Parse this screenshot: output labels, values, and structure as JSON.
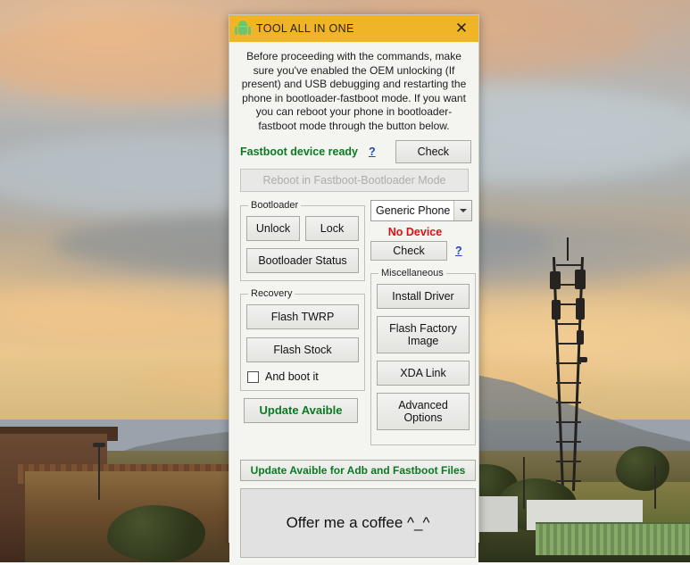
{
  "window": {
    "title": "TOOL ALL IN ONE",
    "icon": "android-robot-icon",
    "close_label": "✕",
    "titlebar_color": "#f0b429"
  },
  "intro_text": "Before proceeding with the commands, make sure you've enabled the OEM unlocking (If present) and USB debugging and restarting the phone in bootloader-fastboot mode. If you want you can reboot your phone in bootloader-fastboot mode through the button below.",
  "fastboot": {
    "status_text": "Fastboot device ready",
    "status_color": "#0a7a22",
    "help_label": "?",
    "check_label": "Check",
    "reboot_label": "Reboot in Fastboot-Bootloader Mode",
    "reboot_enabled": false
  },
  "bootloader": {
    "legend": "Bootloader",
    "unlock_label": "Unlock",
    "lock_label": "Lock",
    "status_label": "Bootloader Status"
  },
  "recovery": {
    "legend": "Recovery",
    "flash_twrp_label": "Flash TWRP",
    "flash_stock_label": "Flash Stock",
    "and_boot_it_label": "And boot it",
    "and_boot_it_checked": false
  },
  "device": {
    "selected_phone": "Generic Phone",
    "options": [
      "Generic Phone"
    ],
    "status_text": "No Device",
    "status_color": "#e01010",
    "check_label": "Check",
    "help_label": "?"
  },
  "miscellaneous": {
    "legend": "Miscellaneous",
    "install_driver_label": "Install Driver",
    "flash_factory_image_label": "Flash Factory Image",
    "xda_link_label": "XDA Link",
    "advanced_options_label": "Advanced Options"
  },
  "updates": {
    "update_button_label": "Update Avaible",
    "update_bar_label": "Update Avaible for Adb and Fastboot Files",
    "update_color": "#0a7a22"
  },
  "donate": {
    "coffee_label": "Offer me a coffee  ^_^"
  }
}
